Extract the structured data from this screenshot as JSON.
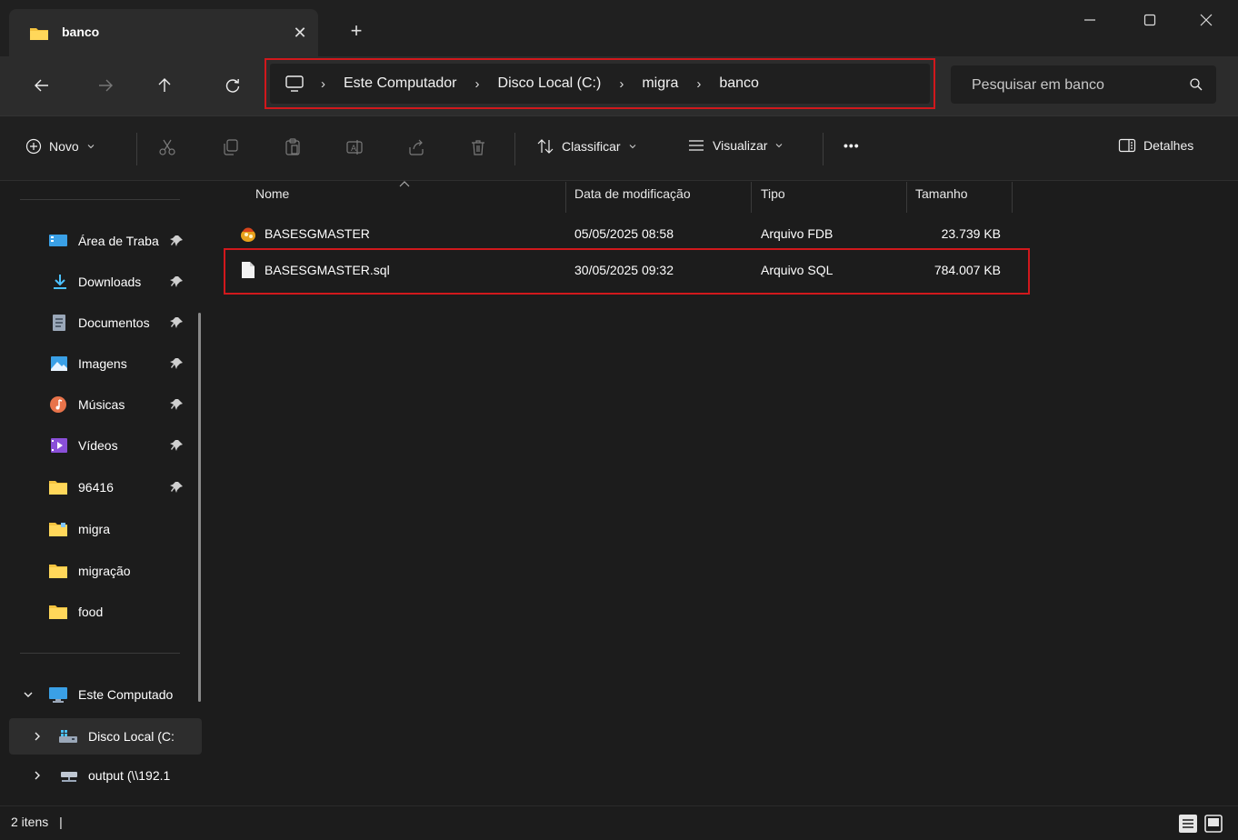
{
  "tab": {
    "title": "banco",
    "close": "✕",
    "new": "+"
  },
  "window": {
    "minimize": "—",
    "maximize": "☐",
    "close": "✕"
  },
  "address": {
    "crumbs": [
      "Este Computador",
      "Disco Local (C:)",
      "migra",
      "banco"
    ],
    "separator": "›"
  },
  "search": {
    "placeholder": "Pesquisar em banco"
  },
  "toolbar": {
    "new_label": "Novo",
    "sort_label": "Classificar",
    "view_label": "Visualizar",
    "more_label": "•••",
    "details_label": "Detalhes"
  },
  "sidebar": {
    "quick_access": [
      {
        "label": "Área de Traba",
        "icon": "desktop-icon"
      },
      {
        "label": "Downloads",
        "icon": "download-icon"
      },
      {
        "label": "Documentos",
        "icon": "documents-icon"
      },
      {
        "label": "Imagens",
        "icon": "pictures-icon"
      },
      {
        "label": "Músicas",
        "icon": "music-icon"
      },
      {
        "label": "Vídeos",
        "icon": "videos-icon"
      },
      {
        "label": "96416",
        "icon": "folder-icon"
      },
      {
        "label": "migra",
        "icon": "folder-icon"
      },
      {
        "label": "migração",
        "icon": "folder-icon"
      },
      {
        "label": "food",
        "icon": "folder-icon"
      }
    ],
    "this_pc": "Este Computado",
    "drive": "Disco Local (C:",
    "network": "output (\\\\192.1"
  },
  "columns": [
    "Nome",
    "Data de modificação",
    "Tipo",
    "Tamanho"
  ],
  "files": [
    {
      "name": "BASESGMASTER",
      "modified": "05/05/2025 08:58",
      "type": "Arquivo FDB",
      "size": "23.739 KB"
    },
    {
      "name": "BASESGMASTER.sql",
      "modified": "30/05/2025 09:32",
      "type": "Arquivo SQL",
      "size": "784.007 KB"
    }
  ],
  "status": {
    "count": "2 itens",
    "separator": "|"
  },
  "colors": {
    "highlight": "#d1181c",
    "folder": "#f4c33f",
    "accent": "#4cc2ff"
  }
}
